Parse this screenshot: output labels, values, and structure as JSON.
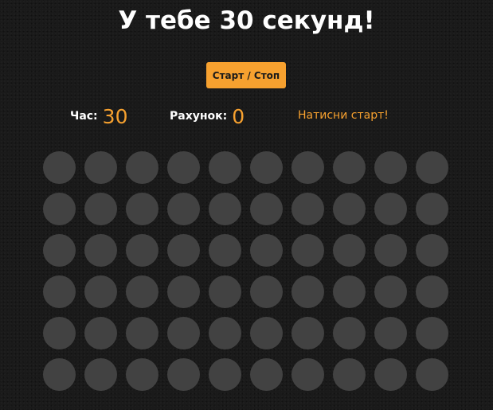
{
  "title": "У тебе 30 секунд!",
  "start_button": {
    "label": "Старт / Стоп"
  },
  "stats": {
    "time_label": "Час:",
    "time_value": "30",
    "score_label": "Рахунок:",
    "score_value": "0"
  },
  "message": "Натисни старт!",
  "grid": {
    "rows": 6,
    "columns": 10
  },
  "colors": {
    "accent": "#f7a12f",
    "background": "#1a1a1a",
    "hole": "#424242",
    "text": "#ffffff"
  }
}
